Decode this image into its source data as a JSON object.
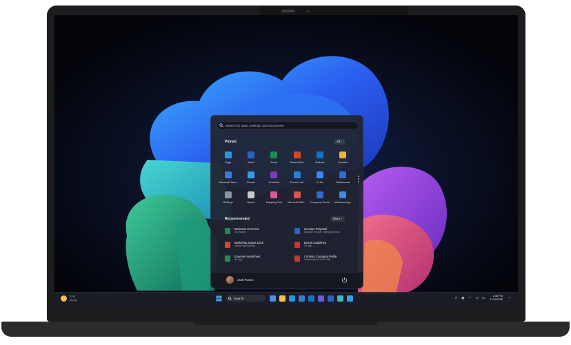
{
  "start_menu": {
    "search_placeholder": "Search for apps, settings, and documents",
    "pinned_title": "Pinned",
    "all_button": "All  ›",
    "pinned_apps": [
      {
        "label": "Edge",
        "icon": "edge-icon",
        "color": "#1f9ae0"
      },
      {
        "label": "Word",
        "icon": "word-icon",
        "color": "#2b62c8"
      },
      {
        "label": "Excel",
        "icon": "excel-icon",
        "color": "#1e8c4e"
      },
      {
        "label": "PowerPoint",
        "icon": "powerpoint-icon",
        "color": "#d24726"
      },
      {
        "label": "Outlook",
        "icon": "outlook-icon",
        "color": "#1572c9"
      },
      {
        "label": "Contoso",
        "icon": "contoso-icon",
        "color": "#e8b43a"
      },
      {
        "label": "Microsoft Store",
        "icon": "store-icon",
        "color": "#3a7bd5"
      },
      {
        "label": "Photos",
        "icon": "photos-icon",
        "color": "#33a0e8"
      },
      {
        "label": "OneNote",
        "icon": "onenote-icon",
        "color": "#7a3db8"
      },
      {
        "label": "Phone Link",
        "icon": "phone-link-icon",
        "color": "#2f7fd8"
      },
      {
        "label": "To Do",
        "icon": "todo-icon",
        "color": "#3f86f0"
      },
      {
        "label": "Whiteboard",
        "icon": "whiteboard-icon",
        "color": "#2a6fd8"
      },
      {
        "label": "Settings",
        "icon": "settings-icon",
        "color": "#8a93a8"
      },
      {
        "label": "Sports",
        "icon": "sports-icon",
        "color": "#c9c9c9"
      },
      {
        "label": "Snipping Tool",
        "icon": "snipping-tool-icon",
        "color": "#d95a9b"
      },
      {
        "label": "Microsoft 365...",
        "icon": "m365-icon",
        "color": "#d9534f"
      },
      {
        "label": "Company Portal",
        "icon": "company-portal-icon",
        "color": "#2d6bd0"
      },
      {
        "label": "Windows App",
        "icon": "windows-app-icon",
        "color": "#3b8be8"
      }
    ],
    "recommended_title": "Recommended",
    "more_button": "More  ›",
    "recommended": [
      {
        "name": "Business Overview",
        "sub": "All Hands",
        "icon": "excel-file-icon",
        "color": "#1e8c4e"
      },
      {
        "name": "Contoso Proposal",
        "sub": "Multiple people edited just now",
        "icon": "word-file-icon",
        "color": "#2b62c8"
      },
      {
        "name": "Marketing Status Deck",
        "sub": "Marketing Weekly",
        "icon": "powerpoint-file-icon",
        "color": "#d24726"
      },
      {
        "name": "Brand Guidelines",
        "sub": "2h ago",
        "icon": "pdf-file-icon",
        "color": "#c8372d"
      },
      {
        "name": "Expense Worksheet",
        "sub": "4h ago",
        "icon": "excel-file-icon",
        "color": "#1e8c4e"
      },
      {
        "name": "Contoso Company Profile",
        "sub": "Yesterday at 10:50 AM",
        "icon": "pdf-file-icon",
        "color": "#c8372d"
      }
    ],
    "user_name": "Jack Purton"
  },
  "taskbar": {
    "weather_temp": "71°F",
    "weather_desc": "Sunny",
    "search_label": "Search",
    "pinned_icons": [
      "widgets-icon",
      "file-explorer-icon",
      "edge-icon",
      "store-icon",
      "outlook-icon",
      "teams-icon",
      "word-icon",
      "copilot-icon",
      "photos-icon"
    ],
    "clock_time": "2:30 PM",
    "clock_date": "11/19/2025"
  },
  "colors": {
    "accent": "#2f7fd8",
    "panel": "#202430",
    "taskbar": "#1c1e28"
  }
}
